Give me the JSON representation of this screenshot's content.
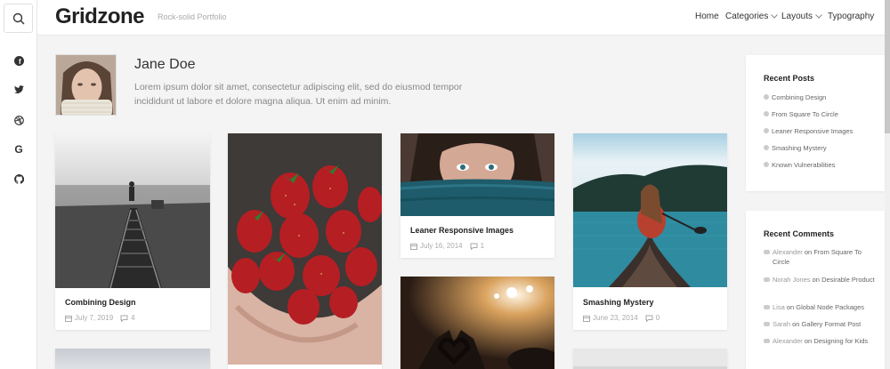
{
  "site": {
    "logo": "Gridzone",
    "tagline": "Rock-solid Portfolio"
  },
  "nav": {
    "home": "Home",
    "categories": "Categories",
    "layouts": "Layouts",
    "typography": "Typography"
  },
  "social": {
    "facebook": "f",
    "google": "G"
  },
  "author": {
    "name": "Jane Doe",
    "bio": "Lorem ipsum dolor sit amet, consectetur adipiscing elit, sed do eiusmod tempor incididunt ut labore et dolore magna aliqua. Ut enim ad minim."
  },
  "posts": [
    {
      "title": "Combining Design",
      "date": "July 7, 2019",
      "comments": "4"
    },
    {
      "title": "Leaner Responsive Images",
      "date": "July 16, 2014",
      "comments": "1"
    },
    {
      "title": "Smashing Mystery",
      "date": "June 23, 2014",
      "comments": "0"
    }
  ],
  "recent_posts": {
    "title": "Recent Posts",
    "items": [
      "Combining Design",
      "From Square To Circle",
      "Leaner Responsive Images",
      "Smashing Mystery",
      "Known Vulnerabilities"
    ]
  },
  "recent_comments": {
    "title": "Recent Comments",
    "on": "on",
    "items": [
      {
        "author": "Alexander",
        "post": "From Square To Circle"
      },
      {
        "author": "Norah Jones",
        "post": "Desirable Product"
      },
      {
        "author": "Lisa",
        "post": "Global Node Packages"
      },
      {
        "author": "Sarah",
        "post": "Gallery Format Post"
      },
      {
        "author": "Alexander",
        "post": "Designing for Kids"
      }
    ]
  },
  "colors": {
    "background": "#f4f4f4",
    "card": "#ffffff",
    "text": "#222222",
    "muted": "#aaaaaa"
  }
}
